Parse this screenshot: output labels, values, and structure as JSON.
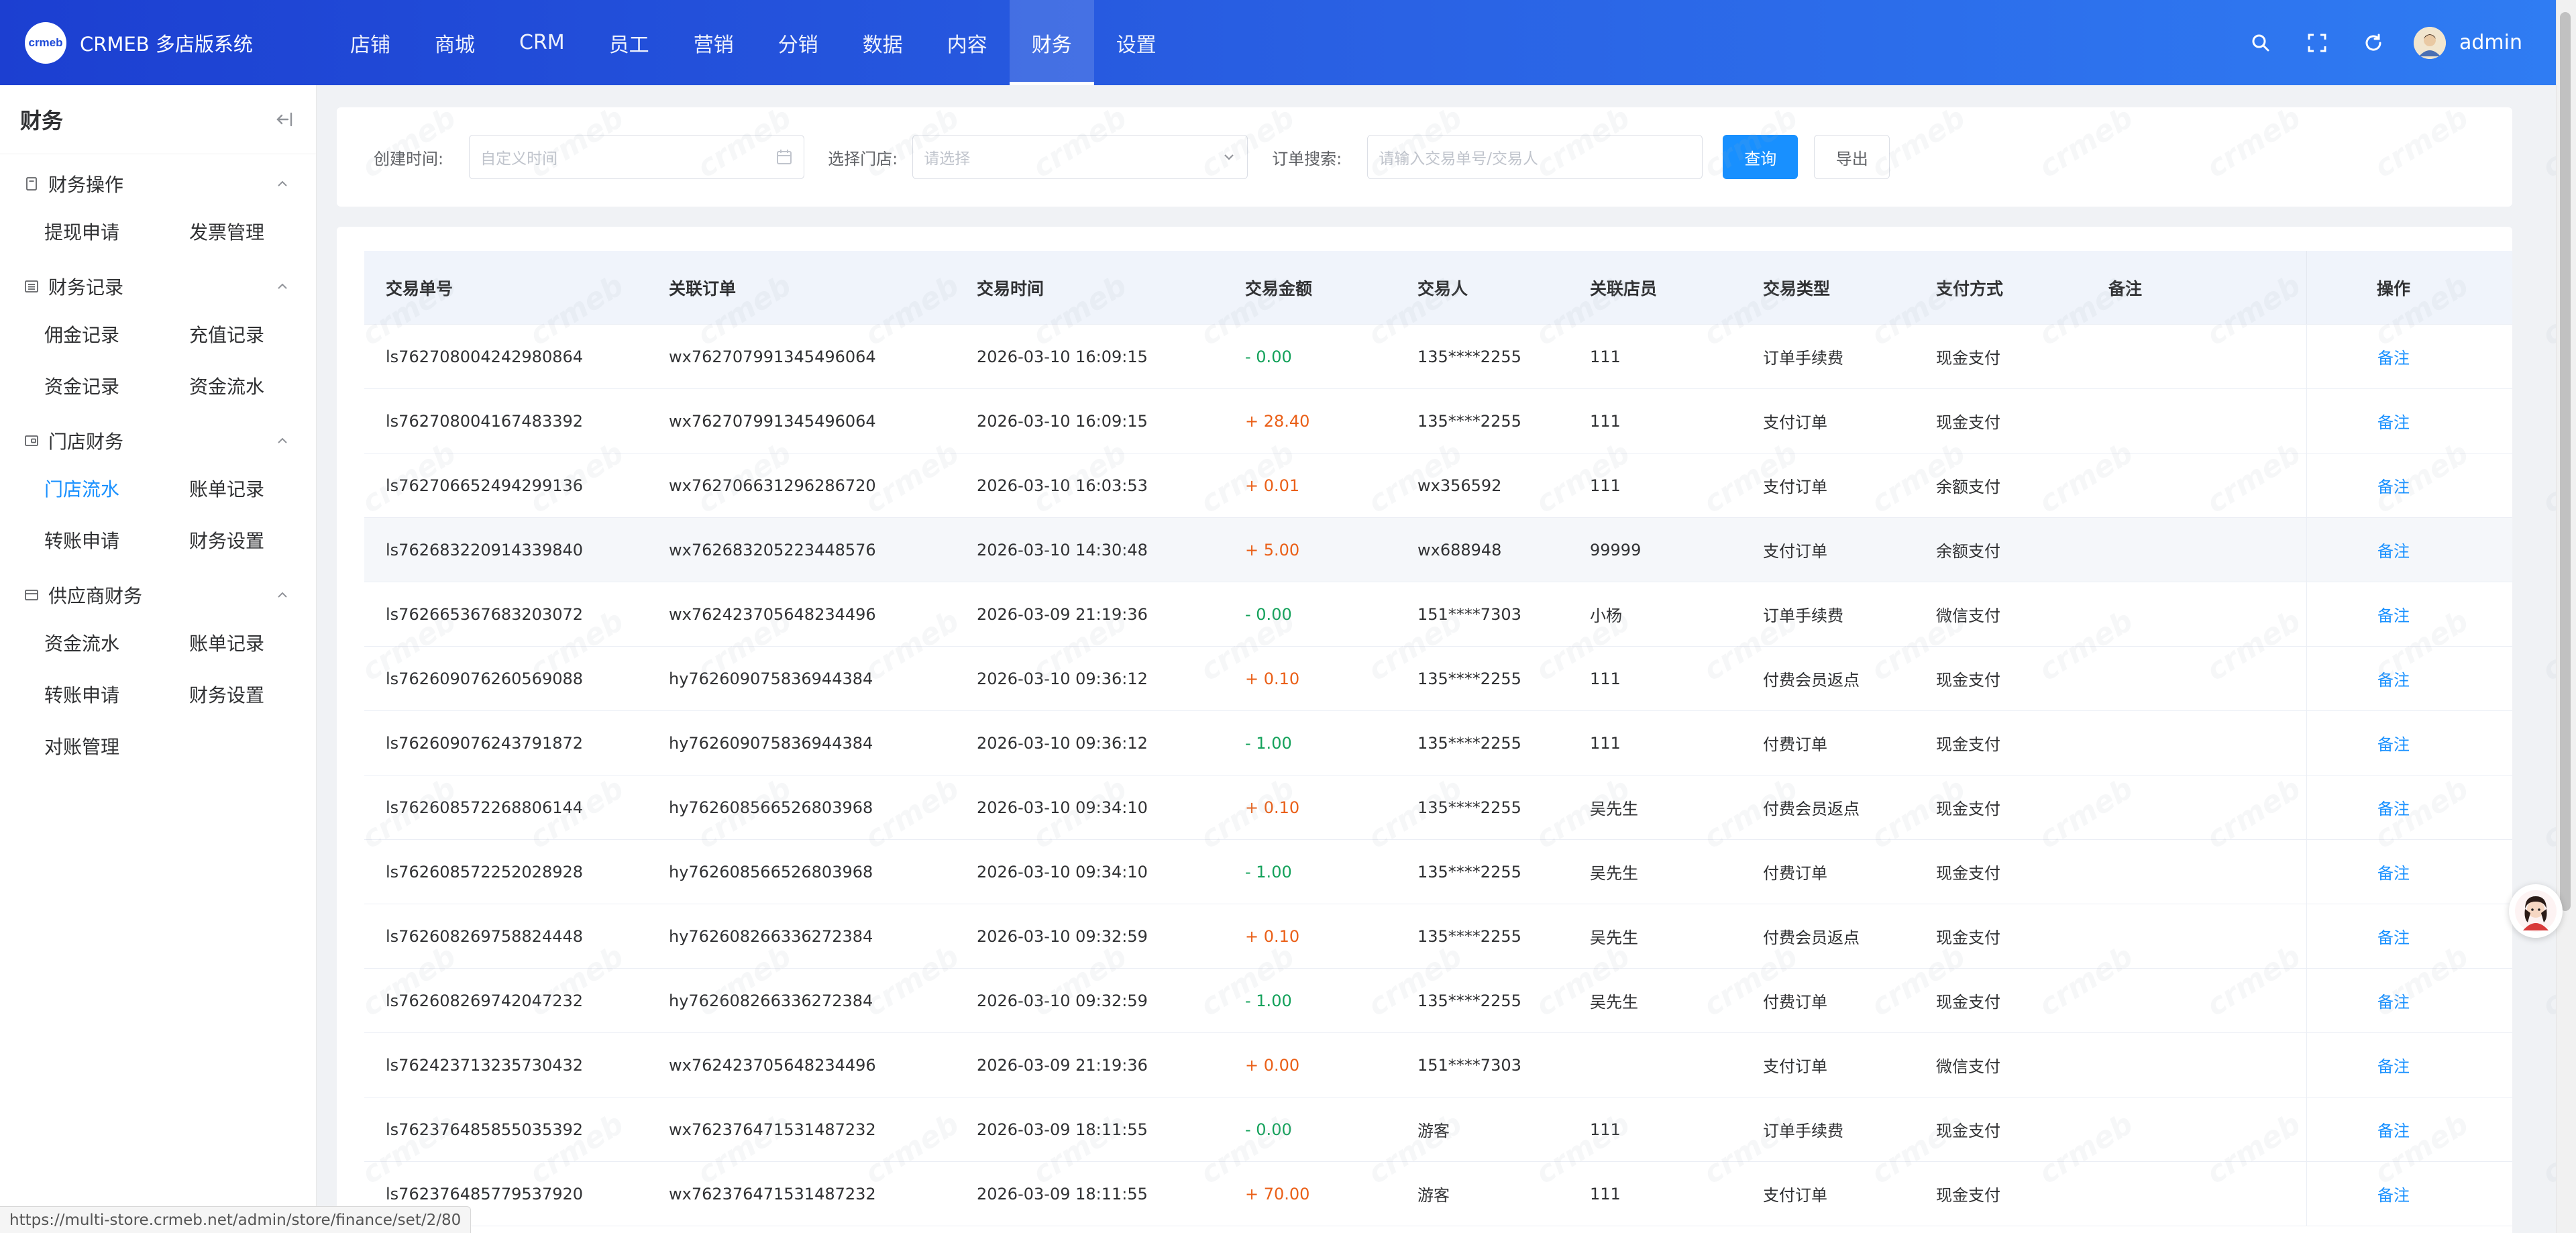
{
  "app": {
    "logo_text": "crmeb",
    "title": "CRMEB 多店版系统"
  },
  "topnav": [
    {
      "label": "店铺",
      "active": false
    },
    {
      "label": "商城",
      "active": false
    },
    {
      "label": "CRM",
      "active": false
    },
    {
      "label": "员工",
      "active": false
    },
    {
      "label": "营销",
      "active": false
    },
    {
      "label": "分销",
      "active": false
    },
    {
      "label": "数据",
      "active": false
    },
    {
      "label": "内容",
      "active": false
    },
    {
      "label": "财务",
      "active": true
    },
    {
      "label": "设置",
      "active": false
    }
  ],
  "header_icons": [
    "search-icon",
    "fullscreen-icon",
    "refresh-icon"
  ],
  "user": {
    "name": "admin"
  },
  "sidebar": {
    "title": "财务",
    "groups": [
      {
        "label": "财务操作",
        "icon": "document-icon",
        "items": [
          "提现申请",
          "发票管理"
        ]
      },
      {
        "label": "财务记录",
        "icon": "list-icon",
        "items": [
          "佣金记录",
          "充值记录",
          "资金记录",
          "资金流水"
        ]
      },
      {
        "label": "门店财务",
        "icon": "wallet-icon",
        "items": [
          "门店流水",
          "账单记录",
          "转账申请",
          "财务设置"
        ],
        "active_item": "门店流水"
      },
      {
        "label": "供应商财务",
        "icon": "card-icon",
        "items": [
          "资金流水",
          "账单记录",
          "转账申请",
          "财务设置",
          "对账管理"
        ]
      }
    ]
  },
  "filters": {
    "created_time_label": "创建时间:",
    "created_time_placeholder": "自定义时间",
    "store_label": "选择门店:",
    "store_placeholder": "请选择",
    "order_search_label": "订单搜索:",
    "order_search_placeholder": "请输入交易单号/交易人",
    "query_button": "查询",
    "export_button": "导出"
  },
  "table": {
    "columns": [
      "交易单号",
      "关联订单",
      "交易时间",
      "交易金额",
      "交易人",
      "关联店员",
      "交易类型",
      "支付方式",
      "备注",
      "操作"
    ],
    "action_label": "备注",
    "rows": [
      {
        "no": "ls762708004242980864",
        "order": "wx762707991345496064",
        "time": "2026-03-10 16:09:15",
        "amount": "- 0.00",
        "sign": "neg",
        "person": "135****2255",
        "clerk": "111",
        "type": "订单手续费",
        "pay": "现金支付",
        "remark": ""
      },
      {
        "no": "ls762708004167483392",
        "order": "wx762707991345496064",
        "time": "2026-03-10 16:09:15",
        "amount": "+ 28.40",
        "sign": "pos",
        "person": "135****2255",
        "clerk": "111",
        "type": "支付订单",
        "pay": "现金支付",
        "remark": ""
      },
      {
        "no": "ls762706652494299136",
        "order": "wx762706631296286720",
        "time": "2026-03-10 16:03:53",
        "amount": "+ 0.01",
        "sign": "pos",
        "person": "wx356592",
        "clerk": "111",
        "type": "支付订单",
        "pay": "余额支付",
        "remark": ""
      },
      {
        "no": "ls762683220914339840",
        "order": "wx762683205223448576",
        "time": "2026-03-10 14:30:48",
        "amount": "+ 5.00",
        "sign": "pos",
        "person": "wx688948",
        "clerk": "99999",
        "type": "支付订单",
        "pay": "余额支付",
        "remark": ""
      },
      {
        "no": "ls762665367683203072",
        "order": "wx762423705648234496",
        "time": "2026-03-09 21:19:36",
        "amount": "- 0.00",
        "sign": "neg",
        "person": "151****7303",
        "clerk": "小杨",
        "type": "订单手续费",
        "pay": "微信支付",
        "remark": ""
      },
      {
        "no": "ls762609076260569088",
        "order": "hy762609075836944384",
        "time": "2026-03-10 09:36:12",
        "amount": "+ 0.10",
        "sign": "pos",
        "person": "135****2255",
        "clerk": "111",
        "type": "付费会员返点",
        "pay": "现金支付",
        "remark": ""
      },
      {
        "no": "ls762609076243791872",
        "order": "hy762609075836944384",
        "time": "2026-03-10 09:36:12",
        "amount": "- 1.00",
        "sign": "neg",
        "person": "135****2255",
        "clerk": "111",
        "type": "付费订单",
        "pay": "现金支付",
        "remark": ""
      },
      {
        "no": "ls762608572268806144",
        "order": "hy762608566526803968",
        "time": "2026-03-10 09:34:10",
        "amount": "+ 0.10",
        "sign": "pos",
        "person": "135****2255",
        "clerk": "吴先生",
        "type": "付费会员返点",
        "pay": "现金支付",
        "remark": ""
      },
      {
        "no": "ls762608572252028928",
        "order": "hy762608566526803968",
        "time": "2026-03-10 09:34:10",
        "amount": "- 1.00",
        "sign": "neg",
        "person": "135****2255",
        "clerk": "吴先生",
        "type": "付费订单",
        "pay": "现金支付",
        "remark": ""
      },
      {
        "no": "ls762608269758824448",
        "order": "hy762608266336272384",
        "time": "2026-03-10 09:32:59",
        "amount": "+ 0.10",
        "sign": "pos",
        "person": "135****2255",
        "clerk": "吴先生",
        "type": "付费会员返点",
        "pay": "现金支付",
        "remark": ""
      },
      {
        "no": "ls762608269742047232",
        "order": "hy762608266336272384",
        "time": "2026-03-10 09:32:59",
        "amount": "- 1.00",
        "sign": "neg",
        "person": "135****2255",
        "clerk": "吴先生",
        "type": "付费订单",
        "pay": "现金支付",
        "remark": ""
      },
      {
        "no": "ls762423713235730432",
        "order": "wx762423705648234496",
        "time": "2026-03-09 21:19:36",
        "amount": "+ 0.00",
        "sign": "pos",
        "person": "151****7303",
        "clerk": "",
        "type": "支付订单",
        "pay": "微信支付",
        "remark": ""
      },
      {
        "no": "ls762376485855035392",
        "order": "wx762376471531487232",
        "time": "2026-03-09 18:11:55",
        "amount": "- 0.00",
        "sign": "neg",
        "person": "游客",
        "clerk": "111",
        "type": "订单手续费",
        "pay": "现金支付",
        "remark": ""
      },
      {
        "no": "ls762376485779537920",
        "order": "wx762376471531487232",
        "time": "2026-03-09 18:11:55",
        "amount": "+ 70.00",
        "sign": "pos",
        "person": "游客",
        "clerk": "111",
        "type": "支付订单",
        "pay": "现金支付",
        "remark": ""
      }
    ]
  },
  "watermark_text": "crmeb",
  "status_url": "https://multi-store.crmeb.net/admin/store/finance/set/2/80",
  "colors": {
    "primary": "#1890ff",
    "header_start": "#1c3fd1",
    "header_end": "#2f7cf3",
    "amount_positive": "#ea5f17",
    "amount_negative": "#13a15a"
  }
}
